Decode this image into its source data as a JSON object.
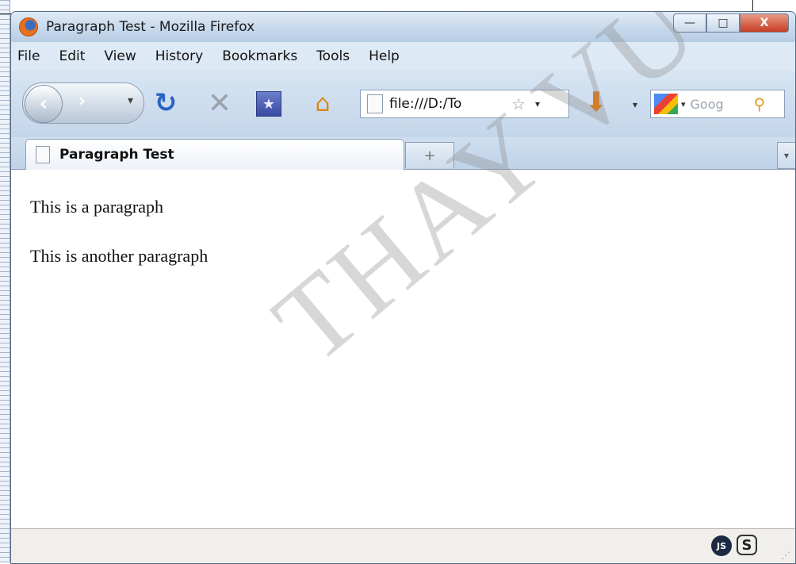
{
  "window": {
    "title": "Paragraph Test - Mozilla Firefox",
    "buttons": {
      "minimize": "—",
      "maximize": "□",
      "close": "X"
    }
  },
  "menubar": {
    "items": [
      {
        "label": "File"
      },
      {
        "label": "Edit"
      },
      {
        "label": "View"
      },
      {
        "label": "History"
      },
      {
        "label": "Bookmarks"
      },
      {
        "label": "Tools"
      },
      {
        "label": "Help"
      }
    ]
  },
  "navbar": {
    "url": "file:///D:/To",
    "search_placeholder": "Goog"
  },
  "tabs": [
    {
      "label": "Paragraph Test",
      "active": true
    }
  ],
  "content": {
    "paragraphs": [
      "This is a paragraph",
      "This is another paragraph"
    ],
    "watermark": "THAY VU"
  },
  "icons": {
    "back": "back-arrow-icon",
    "forward": "forward-arrow-icon",
    "reload": "reload-icon",
    "stop": "stop-icon",
    "bookmark": "bookmark-icon",
    "home": "home-icon",
    "download": "download-icon",
    "search": "magnifier-icon"
  }
}
